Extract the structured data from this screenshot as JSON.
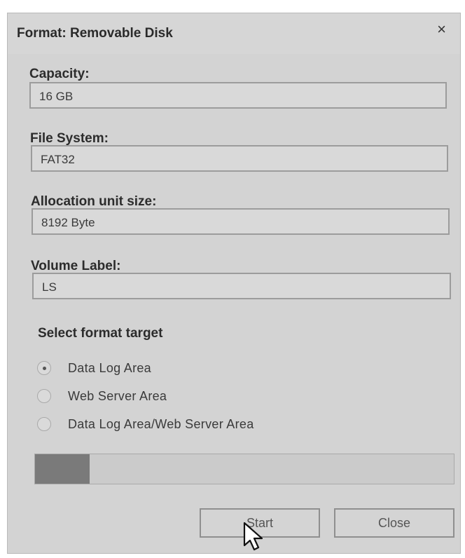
{
  "dialog": {
    "title": "Format: Removable Disk",
    "close_label": "×"
  },
  "fields": {
    "capacity": {
      "label": "Capacity:",
      "value": "16 GB"
    },
    "file_system": {
      "label": "File System:",
      "value": "FAT32"
    },
    "allocation": {
      "label": "Allocation unit size:",
      "value": "8192 Byte"
    },
    "volume_label": {
      "label": "Volume Label:",
      "value": "LS"
    }
  },
  "format_target": {
    "title": "Select format target",
    "options": [
      {
        "label": "Data Log Area",
        "selected": true
      },
      {
        "label": "Web Server Area",
        "selected": false
      },
      {
        "label": "Data Log Area/Web Server Area",
        "selected": false
      }
    ]
  },
  "progress": {
    "value": 0.13
  },
  "buttons": {
    "start": "Start",
    "close": "Close"
  },
  "icons": {
    "close": "close-icon",
    "cursor": "mouse-pointer-icon"
  }
}
